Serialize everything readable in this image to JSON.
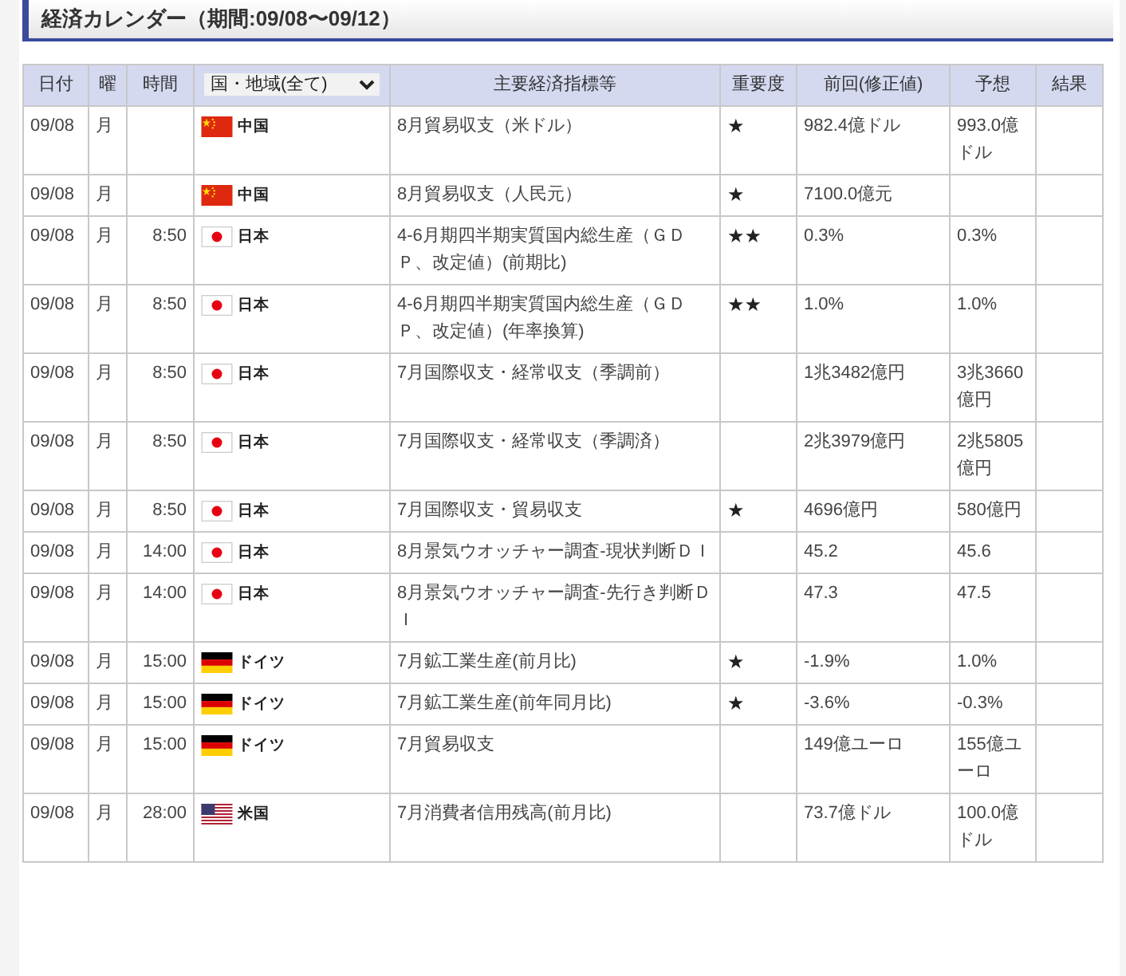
{
  "title": "経済カレンダー（期間:09/08〜09/12）",
  "columns": [
    "日付",
    "曜",
    "時間",
    "国・地域(全て)",
    "主要経済指標等",
    "重要度",
    "前回(修正値)",
    "予想",
    "結果"
  ],
  "rows": [
    {
      "date": "09/08",
      "day": "月",
      "time": "",
      "kind": "cn",
      "country": "中国",
      "indicator": "8月貿易収支（米ドル）",
      "importance": "★",
      "previous": "982.4億ドル",
      "forecast": "993.0億ドル"
    },
    {
      "date": "09/08",
      "day": "月",
      "time": "",
      "kind": "cn",
      "country": "中国",
      "indicator": "8月貿易収支（人民元）",
      "importance": "★",
      "previous": "7100.0億元",
      "forecast": ""
    },
    {
      "date": "09/08",
      "day": "月",
      "time": "8:50",
      "kind": "jp",
      "country": "日本",
      "indicator": "4-6月期四半期実質国内総生産（ＧＤＰ、改定値）(前期比)",
      "importance": "★★",
      "previous": "0.3%",
      "forecast": "0.3%"
    },
    {
      "date": "09/08",
      "day": "月",
      "time": "8:50",
      "kind": "jp",
      "country": "日本",
      "indicator": "4-6月期四半期実質国内総生産（ＧＤＰ、改定値）(年率換算)",
      "importance": "★★",
      "previous": "1.0%",
      "forecast": "1.0%"
    },
    {
      "date": "09/08",
      "day": "月",
      "time": "8:50",
      "kind": "jp",
      "country": "日本",
      "indicator": "7月国際収支・経常収支（季調前）",
      "importance": "",
      "previous": "1兆3482億円",
      "forecast": "3兆3660億円"
    },
    {
      "date": "09/08",
      "day": "月",
      "time": "8:50",
      "kind": "jp",
      "country": "日本",
      "indicator": "7月国際収支・経常収支（季調済）",
      "importance": "",
      "previous": "2兆3979億円",
      "forecast": "2兆5805億円"
    },
    {
      "date": "09/08",
      "day": "月",
      "time": "8:50",
      "kind": "jp",
      "country": "日本",
      "indicator": "7月国際収支・貿易収支",
      "importance": "★",
      "previous": "4696億円",
      "forecast": "580億円"
    },
    {
      "date": "09/08",
      "day": "月",
      "time": "14:00",
      "kind": "jp",
      "country": "日本",
      "indicator": "8月景気ウオッチャー調査-現状判断ＤＩ",
      "importance": "",
      "previous": "45.2",
      "forecast": "45.6"
    },
    {
      "date": "09/08",
      "day": "月",
      "time": "14:00",
      "kind": "jp",
      "country": "日本",
      "indicator": "8月景気ウオッチャー調査-先行き判断ＤＩ",
      "importance": "",
      "previous": "47.3",
      "forecast": "47.5"
    },
    {
      "date": "09/08",
      "day": "月",
      "time": "15:00",
      "kind": "de",
      "country": "ドイツ",
      "indicator": "7月鉱工業生産(前月比)",
      "importance": "★",
      "previous": "-1.9%",
      "forecast": "1.0%"
    },
    {
      "date": "09/08",
      "day": "月",
      "time": "15:00",
      "kind": "de",
      "country": "ドイツ",
      "indicator": "7月鉱工業生産(前年同月比)",
      "importance": "★",
      "previous": "-3.6%",
      "forecast": "-0.3%"
    },
    {
      "date": "09/08",
      "day": "月",
      "time": "15:00",
      "kind": "de",
      "country": "ドイツ",
      "indicator": "7月貿易収支",
      "importance": "",
      "previous": "149億ユーロ",
      "forecast": "155億ユーロ"
    },
    {
      "date": "09/08",
      "day": "月",
      "time": "28:00",
      "kind": "us",
      "country": "米国",
      "indicator": "7月消費者信用残高(前月比)",
      "importance": "",
      "previous": "73.7億ドル",
      "forecast": "100.0億ドル"
    }
  ]
}
